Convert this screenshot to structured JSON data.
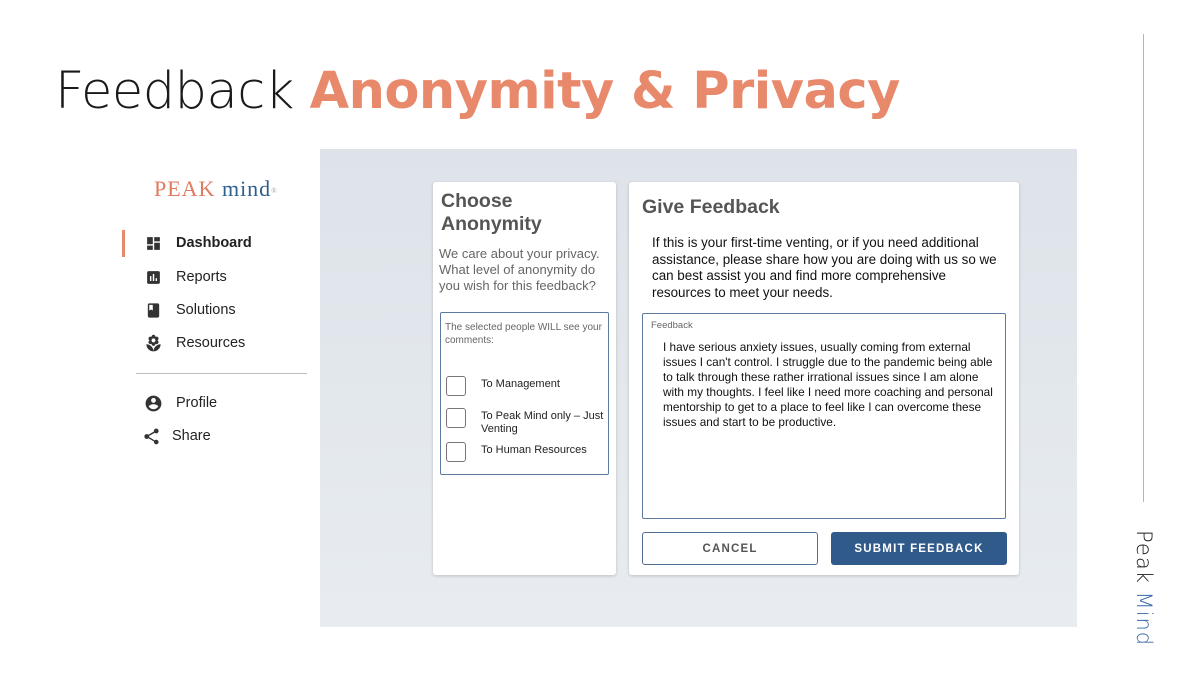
{
  "slide": {
    "title_part1": "Feedback ",
    "title_part2": "Anonymity & Privacy",
    "accent_color": "#e8896b",
    "vertical_brand_1": "Peak ",
    "vertical_brand_2": "Mind"
  },
  "sidebar": {
    "logo": {
      "part1": "PEAK ",
      "part2": "mind",
      "mark": "®"
    },
    "items": [
      {
        "label": "Dashboard",
        "icon": "dashboard-icon",
        "active": true
      },
      {
        "label": "Reports",
        "icon": "bar-chart-icon"
      },
      {
        "label": "Solutions",
        "icon": "book-icon"
      },
      {
        "label": "Resources",
        "icon": "lotus-icon"
      }
    ],
    "secondary": [
      {
        "label": "Profile",
        "icon": "account-circle-icon"
      },
      {
        "label": "Share",
        "icon": "share-icon"
      }
    ]
  },
  "anonymity": {
    "title": "Choose Anonymity",
    "description": "We care about your privacy. What level of anonymity do you wish for this feedback?",
    "note": "The selected people WILL see your comments:",
    "options": [
      {
        "label": "To Management",
        "checked": false
      },
      {
        "label": "To Peak Mind only – Just Venting",
        "checked": false
      },
      {
        "label": "To Human Resources",
        "checked": false
      }
    ]
  },
  "feedback": {
    "title": "Give Feedback",
    "intro": "If this is your first-time venting, or if you need additional assistance, please share how you are doing with us so we can best assist you and find more comprehensive resources to meet your needs.",
    "field_label": "Feedback",
    "field_value": "I have serious anxiety issues, usually coming from external issues I can't control.  I struggle due to the pandemic being able to talk through these rather irrational issues since I am alone with my thoughts.  I feel like I need more coaching and personal mentorship to get to a place to feel like I can overcome these issues and start to be productive.",
    "cancel_label": "CANCEL",
    "submit_label": "SUBMIT FEEDBACK",
    "submit_color": "#2f5a8a"
  }
}
